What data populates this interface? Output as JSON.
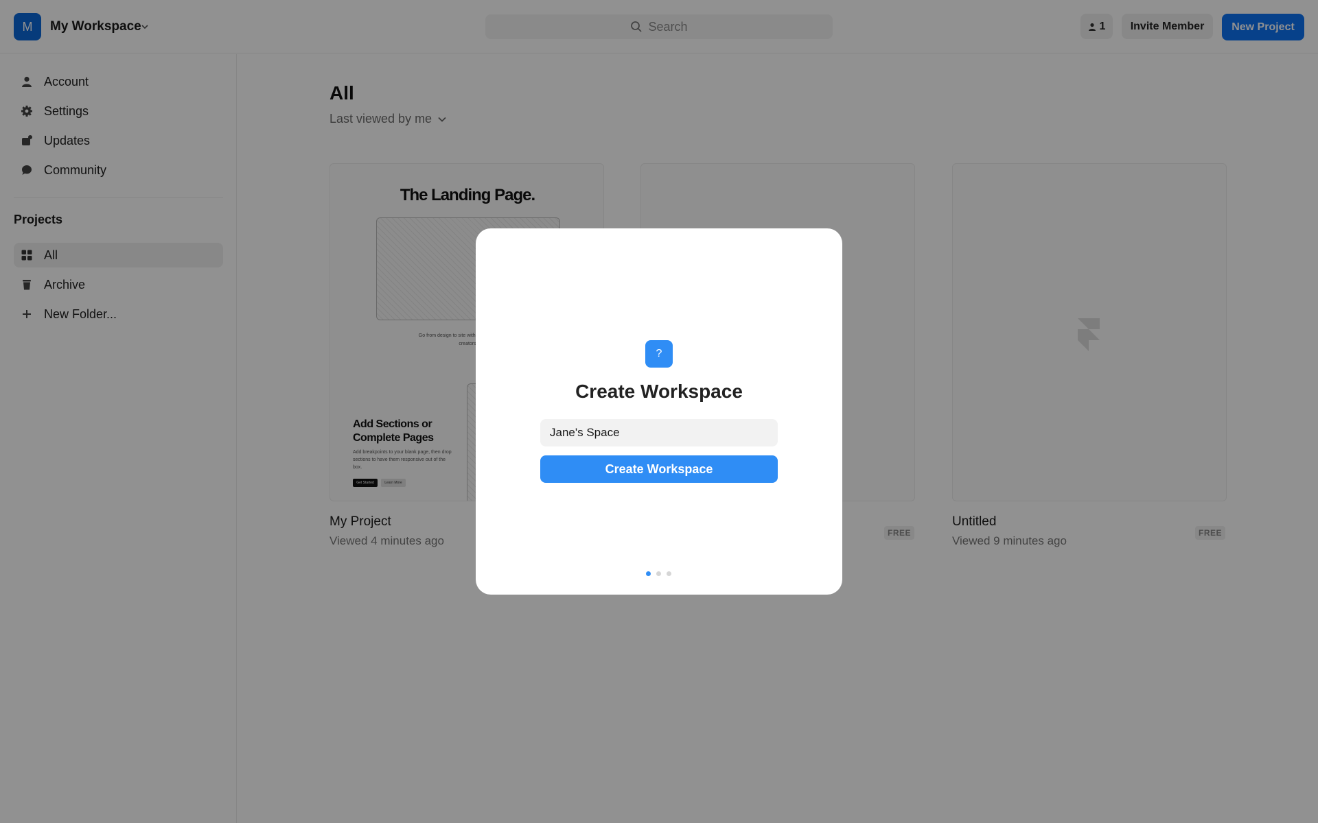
{
  "workspace": {
    "avatar_letter": "M",
    "name": "My Workspace"
  },
  "search": {
    "label": "Search"
  },
  "header": {
    "member_count": "1",
    "invite_label": "Invite Member",
    "new_project_label": "New Project"
  },
  "sidebar": {
    "items": [
      {
        "label": "Account",
        "icon": "person-icon"
      },
      {
        "label": "Settings",
        "icon": "gear-icon"
      },
      {
        "label": "Updates",
        "icon": "updates-icon"
      },
      {
        "label": "Community",
        "icon": "chat-bubble-icon"
      }
    ],
    "projects_title": "Projects",
    "project_items": [
      {
        "label": "All",
        "icon": "grid-icon",
        "active": true
      },
      {
        "label": "Archive",
        "icon": "trash-icon"
      },
      {
        "label": "New Folder...",
        "icon": "plus-icon"
      }
    ]
  },
  "main": {
    "title": "All",
    "sort_label": "Last viewed by me",
    "cards": [
      {
        "title": "My Project",
        "meta": "Viewed 4 minutes ago",
        "thumbnail": {
          "heading": "The Landing Page.",
          "tagline": "Go from design to site with the web builder for creators",
          "section_title": "Add Sections or Complete Pages",
          "section_desc": "Add breakpoints to your blank page, then drop sections to have them responsive out of the box.",
          "primary_btn": "Get Started",
          "secondary_btn": "Learn More"
        }
      },
      {
        "title": "",
        "meta": "",
        "badge": "FREE"
      },
      {
        "title": "Untitled",
        "meta": "Viewed 9 minutes ago",
        "badge": "FREE"
      }
    ]
  },
  "modal": {
    "icon_glyph": "?",
    "title": "Create Workspace",
    "input_value": "Jane's Space",
    "button_label": "Create Workspace",
    "pages": 3,
    "current_page": 1
  },
  "colors": {
    "accent": "#0e73f3",
    "modal_accent": "#2f8df5",
    "overlay": "rgba(0,0,0,0.43)"
  }
}
